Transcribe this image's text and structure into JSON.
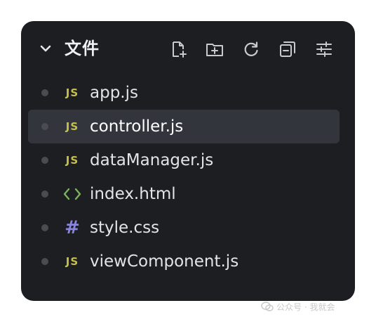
{
  "panel": {
    "title": "文件",
    "toolbar": [
      {
        "icon": "new-file-icon"
      },
      {
        "icon": "new-folder-icon"
      },
      {
        "icon": "refresh-icon"
      },
      {
        "icon": "collapse-all-icon"
      },
      {
        "icon": "settings-sliders-icon"
      }
    ]
  },
  "files": [
    {
      "name": "app.js",
      "type": "js",
      "badge": "JS",
      "selected": false
    },
    {
      "name": "controller.js",
      "type": "js",
      "badge": "JS",
      "selected": true
    },
    {
      "name": "dataManager.js",
      "type": "js",
      "badge": "JS",
      "selected": false
    },
    {
      "name": "index.html",
      "type": "html",
      "badge": "",
      "selected": false
    },
    {
      "name": "style.css",
      "type": "css",
      "badge": "#",
      "selected": false
    },
    {
      "name": "viewComponent.js",
      "type": "js",
      "badge": "JS",
      "selected": false
    }
  ],
  "watermark": {
    "text": "公众号 · 我就会"
  },
  "colors": {
    "panel_bg": "#1d1e22",
    "selected_row_bg": "#33353c",
    "js_badge": "#c9bf4c",
    "html_icon": "#7bb35a",
    "css_badge": "#8b86dd",
    "text": "#e3e4e7"
  }
}
